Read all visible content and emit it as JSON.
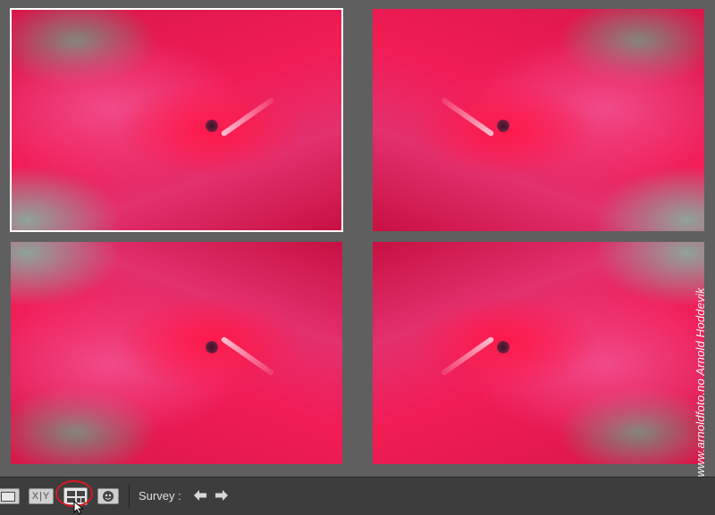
{
  "window": {
    "view_mode": "Survey",
    "photos": [
      {
        "id": "photo-1",
        "selected": true
      },
      {
        "id": "photo-2",
        "selected": false
      },
      {
        "id": "photo-3",
        "selected": false
      },
      {
        "id": "photo-4",
        "selected": false
      }
    ]
  },
  "watermark": {
    "text": "© www.arnoldfoto.no Arnold Hoddevik"
  },
  "toolbar": {
    "compare_label": "X|Y",
    "survey_label": "Survey :",
    "icons": {
      "loupe": "loupe-view-icon",
      "compare": "compare-view-icon",
      "survey": "survey-view-icon",
      "people": "people-view-icon",
      "prev": "arrow-left-icon",
      "next": "arrow-right-icon"
    },
    "colors": {
      "highlight_ring": "#d7191f",
      "toolbar_bg": "#3d3d3d",
      "canvas_bg": "#5f5f5f"
    }
  }
}
